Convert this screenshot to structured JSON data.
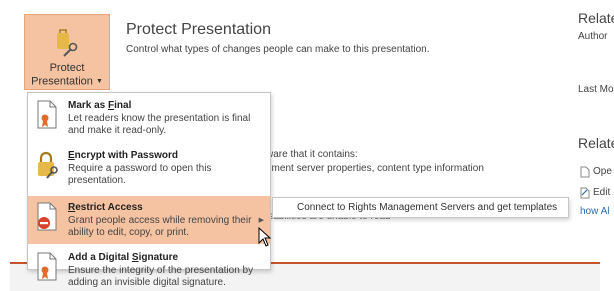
{
  "protect": {
    "button_line1": "Protect",
    "button_line2": "Presentation",
    "title": "Protect Presentation",
    "description": "Control what types of changes people can make to this presentation."
  },
  "inspect": {
    "partial_line1": "ware that it contains:",
    "partial_line2": "ument server properties, content type information",
    "partial_line3": "isabilities are unable to read"
  },
  "related": {
    "heading_properties": "Relate",
    "author": "Author",
    "last_modified": "Last Mo",
    "heading_documents": "Relate",
    "open_file_location": "Ope",
    "edit_links": "Edit",
    "show_all": "how Al"
  },
  "menu": {
    "items": [
      {
        "title_pre": "Mark as ",
        "title_key": "F",
        "title_post": "inal",
        "desc": "Let readers know the presentation is final and make it read-only."
      },
      {
        "title_pre": "",
        "title_key": "E",
        "title_post": "ncrypt with Password",
        "desc": "Require a password to open this presentation."
      },
      {
        "title_pre": "",
        "title_key": "R",
        "title_post": "estrict Access",
        "desc": "Grant people access while removing their ability to edit, copy, or print."
      },
      {
        "title_pre": "Add a Digital ",
        "title_key": "S",
        "title_post": "ignature",
        "desc": "Ensure the integrity of the presentation by adding an invisible digital signature."
      }
    ]
  },
  "submenu": {
    "item": "Connect to Rights Management Servers and get templates"
  },
  "colors": {
    "hover": "#f5c3a1",
    "accent": "#c4522d",
    "link": "#2b6cb0"
  }
}
